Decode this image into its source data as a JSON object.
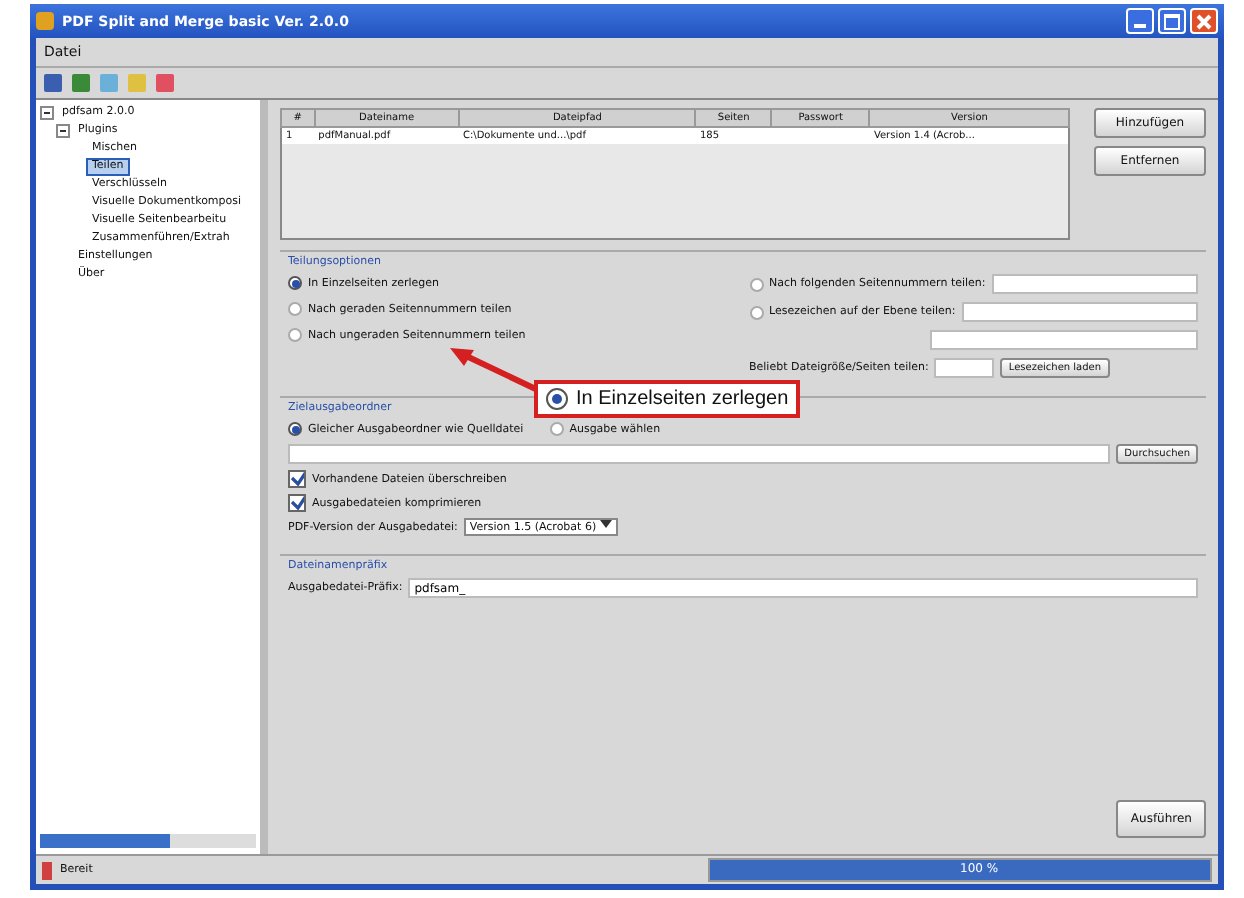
{
  "window": {
    "title": "PDF Split and Merge basic Ver. 2.0.0"
  },
  "menu": [
    "Datei"
  ],
  "tree": [
    {
      "label": "pdfsam 2.0.0",
      "selected": false,
      "expanded": true,
      "children": [
        {
          "label": "Plugins",
          "selected": false,
          "expanded": true,
          "children": [
            {
              "label": "Mischen",
              "selected": false
            },
            {
              "label": "Teilen",
              "selected": true
            },
            {
              "label": "Verschlüsseln",
              "selected": false
            },
            {
              "label": "Visuelle Dokumentkomposi",
              "selected": false
            },
            {
              "label": "Visuelle Seitenbearbeitu",
              "selected": false
            },
            {
              "label": "Zusammenführen/Extrah",
              "selected": false
            }
          ]
        },
        {
          "label": "Einstellungen",
          "selected": false
        },
        {
          "label": "Über",
          "selected": false
        }
      ]
    }
  ],
  "table": {
    "columns": [
      "#",
      "Dateiname",
      "Dateipfad",
      "Seiten",
      "Passwort",
      "Version"
    ],
    "rows": [
      [
        "1",
        "pdfManual.pdf",
        "C:\\Dokumente und...\\pdf",
        "185",
        "",
        "Version 1.4 (Acrob..."
      ]
    ]
  },
  "side_buttons": [
    "Hinzufügen",
    "Entfernen"
  ],
  "split_options": {
    "title": "Teilungsoptionen",
    "options": [
      {
        "label": "In Einzelseiten zerlegen",
        "selected": true
      },
      {
        "label": "Nach geraden Seitennummern teilen",
        "selected": false
      },
      {
        "label": "Nach ungeraden Seitennummern teilen",
        "selected": false
      },
      {
        "label": "Nach folgenden Seitennummern teilen:",
        "selected": false
      },
      {
        "label": "Lesezeichen auf der Ebene teilen:",
        "selected": false
      }
    ],
    "size_label": "Beliebt Dateigröße/Seiten teilen:",
    "size_button": "Lesezeichen laden"
  },
  "callout": {
    "label": "In Einzelseiten zerlegen",
    "selected": true
  },
  "output": {
    "title": "Zielausgabeordner",
    "destinations": [
      {
        "label": "Gleicher Ausgabeordner wie Quelldatei",
        "selected": true
      },
      {
        "label": "Ausgabe wählen",
        "selected": false
      }
    ],
    "browse_button": "Durchsuchen",
    "checks": [
      {
        "label": "Vorhandene Dateien überschreiben",
        "checked": true
      },
      {
        "label": "Ausgabedateien komprimieren",
        "checked": true
      }
    ],
    "version_label": "PDF-Version der Ausgabedatei:",
    "version_value": "Version 1.5 (Acrobat 6)"
  },
  "prefix": {
    "title": "Dateinamenpräfix",
    "label": "Ausgabedatei-Präfix:",
    "value": "pdfsam_"
  },
  "run_button": "Ausführen",
  "status_bar": {
    "text": "Bereit",
    "progress": "100 %",
    "level": 1
  }
}
